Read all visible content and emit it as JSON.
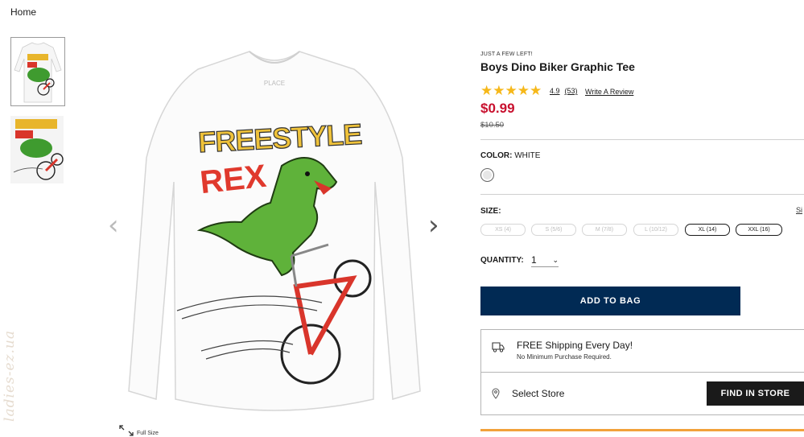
{
  "breadcrumb": {
    "home": "Home"
  },
  "gallery": {
    "thumbnails": [
      {
        "name": "thumb-front",
        "selected": true
      },
      {
        "name": "thumb-graphic",
        "selected": false
      }
    ],
    "prev_icon": "chevron-left-icon",
    "next_icon": "chevron-right-icon",
    "shirt_brand_tag": "PLACE",
    "graphic_line1": "FREESTYLE",
    "graphic_line2": "REX",
    "full_size_label": "Full Size"
  },
  "watermark": "ladies-ez.ua",
  "product": {
    "badge": "JUST A FEW LEFT!",
    "title": "Boys Dino Biker Graphic Tee",
    "rating_value": "4.9",
    "rating_count": "(53)",
    "rating_stars": 4.9,
    "write_review": "Write A Review",
    "price": "$0.99",
    "old_price": "$10.50"
  },
  "color": {
    "label": "COLOR:",
    "value": "WHITE",
    "swatch_hex": "#e7e7e7"
  },
  "size": {
    "label": "SIZE:",
    "guide": "Si",
    "options": [
      {
        "label": "XS (4)",
        "available": false
      },
      {
        "label": "S (5/6)",
        "available": false
      },
      {
        "label": "M (7/8)",
        "available": false
      },
      {
        "label": "L (10/12)",
        "available": false
      },
      {
        "label": "XL (14)",
        "available": true
      },
      {
        "label": "XXL (16)",
        "available": true
      }
    ]
  },
  "quantity": {
    "label": "QUANTITY:",
    "value": "1"
  },
  "actions": {
    "add_to_bag": "ADD TO BAG",
    "find_in_store": "FIND IN STORE"
  },
  "shipping": {
    "title": "FREE Shipping Every Day!",
    "subtitle": "No Minimum Purchase Required.",
    "select_store": "Select Store"
  },
  "colors": {
    "price_red": "#c8102e",
    "navy": "#012a54",
    "star": "#f6b81a",
    "orange": "#f2a13a"
  }
}
